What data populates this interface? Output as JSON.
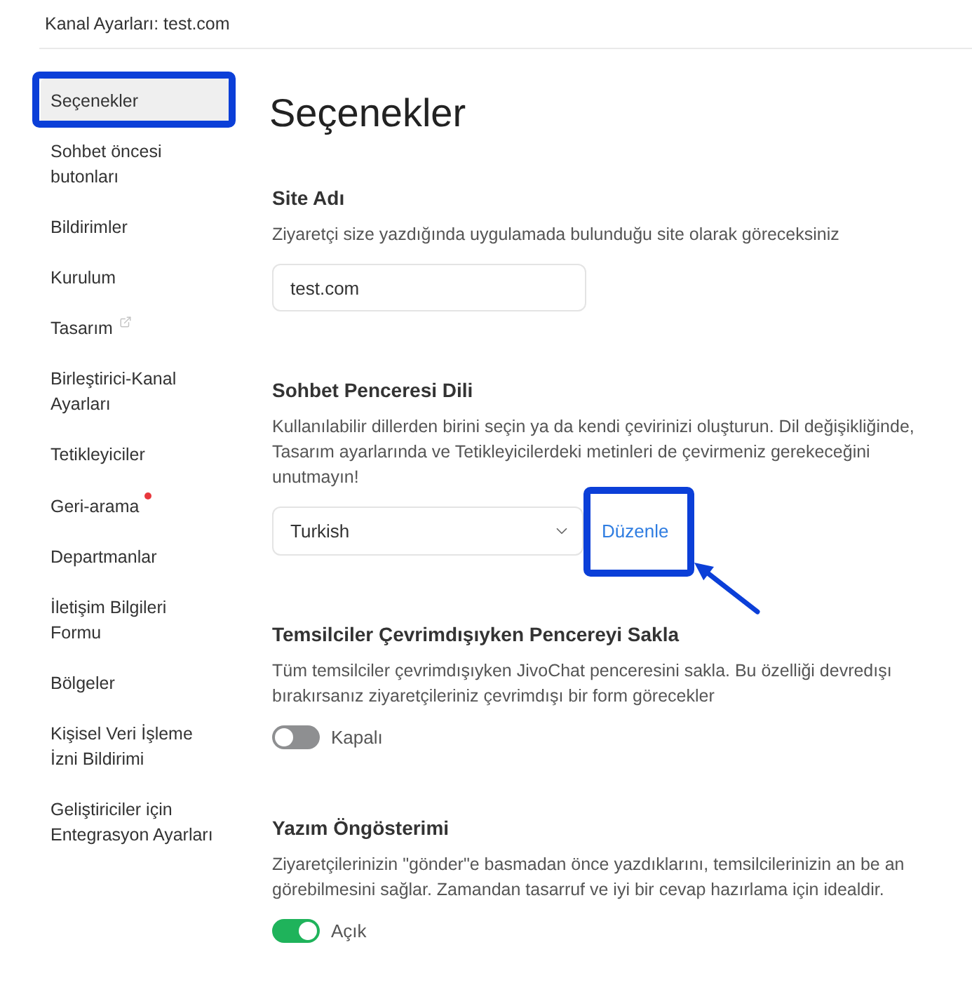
{
  "header": {
    "title": "Kanal Ayarları: test.com"
  },
  "sidebar": {
    "items": [
      {
        "label": "Seçenekler",
        "selected": true,
        "highlighted": true,
        "external": false,
        "notification": false
      },
      {
        "label": "Sohbet öncesi butonları",
        "selected": false,
        "highlighted": false,
        "external": false,
        "notification": false
      },
      {
        "label": "Bildirimler",
        "selected": false,
        "highlighted": false,
        "external": false,
        "notification": false
      },
      {
        "label": "Kurulum",
        "selected": false,
        "highlighted": false,
        "external": false,
        "notification": false
      },
      {
        "label": "Tasarım",
        "selected": false,
        "highlighted": false,
        "external": true,
        "notification": false
      },
      {
        "label": "Birleştirici-Kanal Ayarları",
        "selected": false,
        "highlighted": false,
        "external": false,
        "notification": false
      },
      {
        "label": "Tetikleyiciler",
        "selected": false,
        "highlighted": false,
        "external": false,
        "notification": false
      },
      {
        "label": "Geri-arama",
        "selected": false,
        "highlighted": false,
        "external": false,
        "notification": true
      },
      {
        "label": "Departmanlar",
        "selected": false,
        "highlighted": false,
        "external": false,
        "notification": false
      },
      {
        "label": "İletişim Bilgileri Formu",
        "selected": false,
        "highlighted": false,
        "external": false,
        "notification": false
      },
      {
        "label": "Bölgeler",
        "selected": false,
        "highlighted": false,
        "external": false,
        "notification": false
      },
      {
        "label": "Kişisel Veri İşleme İzni Bildirimi",
        "selected": false,
        "highlighted": false,
        "external": false,
        "notification": false
      },
      {
        "label": "Geliştiriciler için Entegrasyon Ayarları",
        "selected": false,
        "highlighted": false,
        "external": false,
        "notification": false
      }
    ]
  },
  "page": {
    "title": "Seçenekler"
  },
  "sections": [
    {
      "kind": "input",
      "title": "Site Adı",
      "description": "Ziyaretçi size yazdığında uygulamada bulunduğu site olarak göreceksiniz",
      "value": "test.com"
    },
    {
      "kind": "select",
      "title": "Sohbet Penceresi Dili",
      "description": "Kullanılabilir dillerden birini seçin ya da kendi çevirinizi oluşturun. Dil değişikliğinde, Tasarım ayarlarında ve Tetikleyicilerdeki metinleri de çevirmeniz gerekeceğini unutmayın!",
      "value": "Turkish",
      "link": {
        "label": "Düzenle",
        "highlighted": true,
        "arrow": true
      }
    },
    {
      "kind": "toggle",
      "title": "Temsilciler Çevrimdışıyken Pencereyi Sakla",
      "description": "Tüm temsilciler çevrimdışıyken JivoChat penceresini sakla. Bu özelliği devredışı bırakırsanız ziyaretçileriniz çevrimdışı bir form görecekler",
      "on": false,
      "state_label": "Kapalı"
    },
    {
      "kind": "toggle",
      "title": "Yazım Öngösterimi",
      "description": "Ziyaretçilerinizin \"gönder\"e basmadan önce yazdıklarını, temsilcilerinizin an be an görebilmesini sağlar. Zamandan tasarruf ve iyi bir cevap hazırlama için idealdir.",
      "on": true,
      "state_label": "Açık"
    }
  ]
}
